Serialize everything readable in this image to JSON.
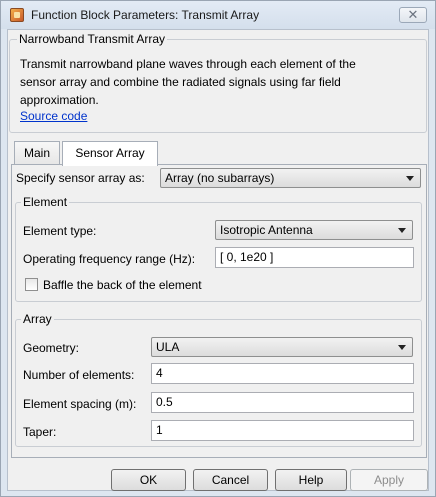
{
  "window": {
    "title": "Function Block Parameters: Transmit Array",
    "close_label": "✕"
  },
  "header": {
    "group_title": "Narrowband Transmit Array",
    "description_lines": [
      "Transmit narrowband plane waves through each element of the",
      "sensor array and combine the radiated signals using far field",
      "approximation."
    ],
    "source_link": "Source code"
  },
  "tabs": [
    {
      "label": "Main",
      "active": false
    },
    {
      "label": "Sensor Array",
      "active": true
    }
  ],
  "sensor_array": {
    "specify_label": "Specify sensor array as:",
    "specify_value": "Array (no subarrays)"
  },
  "element": {
    "group_title": "Element",
    "type_label": "Element type:",
    "type_value": "Isotropic Antenna",
    "freq_label": "Operating frequency range (Hz):",
    "freq_value": "[ 0, 1e20 ]",
    "baffle_label": "Baffle the back of the element",
    "baffle_checked": false
  },
  "array": {
    "group_title": "Array",
    "geometry_label": "Geometry:",
    "geometry_value": "ULA",
    "num_label": "Number of elements:",
    "num_value": "4",
    "spacing_label": "Element spacing (m):",
    "spacing_value": "0.5",
    "taper_label": "Taper:",
    "taper_value": "1"
  },
  "buttons": {
    "ok": "OK",
    "cancel": "Cancel",
    "help": "Help",
    "apply": "Apply"
  }
}
